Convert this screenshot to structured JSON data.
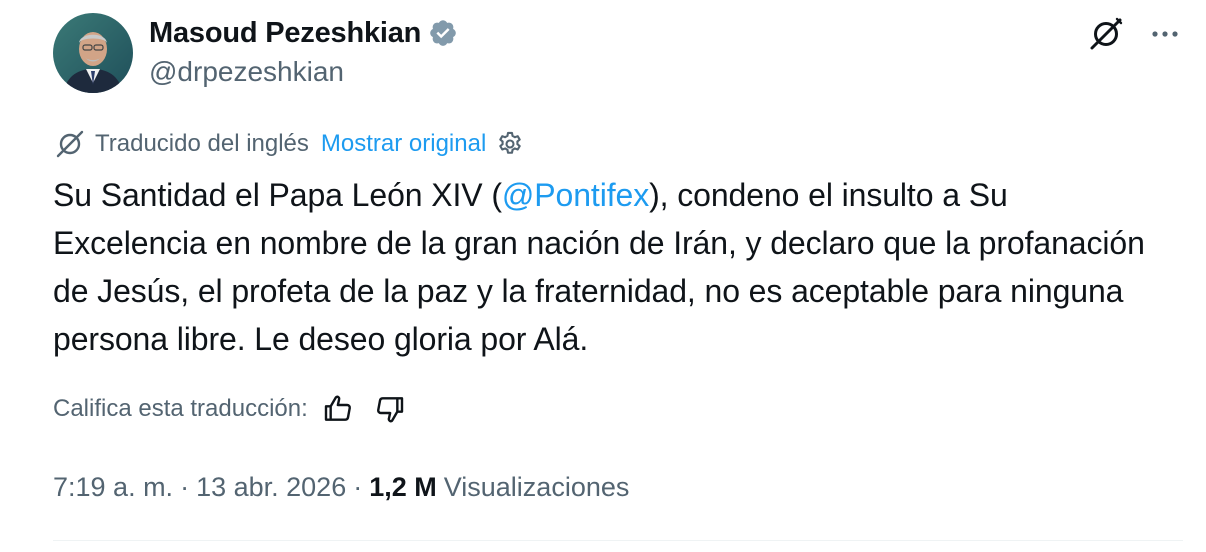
{
  "author": {
    "display_name": "Masoud Pezeshkian",
    "handle": "@drpezeshkian",
    "verified_badge_color": "#829aab"
  },
  "translation": {
    "label": "Traducido del inglés",
    "show_original": "Mostrar original"
  },
  "tweet": {
    "text_before_mention": "Su Santidad el Papa León XIV (",
    "mention": "@Pontifex",
    "text_after_mention": "), condeno el insulto a Su Excelencia en nombre de la gran nación de Irán, y declaro que la profanación de Jesús, el profeta de la paz y la fraternidad, no es aceptable para ninguna persona libre. Le deseo gloria por Alá."
  },
  "rating": {
    "label": "Califica esta traducción:"
  },
  "meta": {
    "time": "7:19 a. m.",
    "separator": "·",
    "date": "13 abr. 2026",
    "views_count": "1,2 M",
    "views_label": "Visualizaciones"
  },
  "icons": {
    "top_right": [
      "grok-icon",
      "more-icon"
    ],
    "translation": "translate-icon",
    "settings": "settings-icon",
    "rating": [
      "thumbs-up-icon",
      "thumbs-down-icon"
    ]
  },
  "colors": {
    "link": "#1d9bf0",
    "secondary_text": "#536471",
    "primary_text": "#0f1419"
  }
}
